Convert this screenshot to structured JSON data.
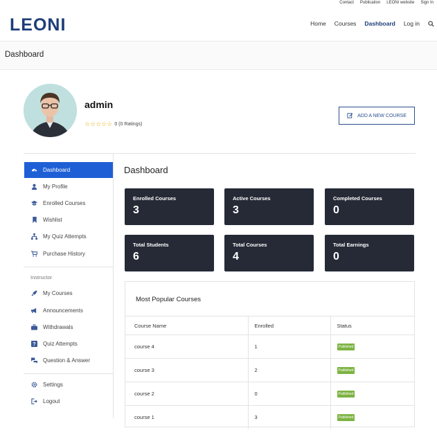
{
  "header": {
    "top_links": [
      "Contact",
      "Publication",
      "LEONI website",
      "Sign In"
    ],
    "logo": "LEONI",
    "nav": [
      {
        "label": "Home",
        "active": false
      },
      {
        "label": "Courses",
        "active": false
      },
      {
        "label": "Dashboard",
        "active": true
      },
      {
        "label": "Log in",
        "active": false
      }
    ],
    "search_icon": "search-icon"
  },
  "page": {
    "title": "Dashboard"
  },
  "profile": {
    "username": "admin",
    "stars": "☆☆☆☆☆",
    "rating_text": "0 (0 Ratings)",
    "add_course_label": "ADD A NEW COURSE"
  },
  "sidebar": {
    "items": [
      {
        "label": "Dashboard",
        "icon": "dashboard-icon",
        "active": true
      },
      {
        "label": "My Profile",
        "icon": "user-icon"
      },
      {
        "label": "Enrolled Courses",
        "icon": "graduation-cap-icon"
      },
      {
        "label": "Wishlist",
        "icon": "bookmark-icon"
      },
      {
        "label": "My Quiz Attempts",
        "icon": "sitemap-icon"
      },
      {
        "label": "Purchase History",
        "icon": "cart-icon"
      }
    ],
    "instructor_label": "Instructor",
    "instructor_items": [
      {
        "label": "My Courses",
        "icon": "rocket-icon"
      },
      {
        "label": "Announcements",
        "icon": "megaphone-icon"
      },
      {
        "label": "Withdrawals",
        "icon": "briefcase-icon"
      },
      {
        "label": "Quiz Attempts",
        "icon": "quiz-icon"
      },
      {
        "label": "Question & Answer",
        "icon": "qa-icon"
      }
    ],
    "bottom_items": [
      {
        "label": "Settings",
        "icon": "gear-icon"
      },
      {
        "label": "Logout",
        "icon": "logout-icon"
      }
    ]
  },
  "main": {
    "title": "Dashboard",
    "stats": [
      {
        "label": "Enrolled Courses",
        "value": "3"
      },
      {
        "label": "Active Courses",
        "value": "3"
      },
      {
        "label": "Completed Courses",
        "value": "0"
      },
      {
        "label": "Total Students",
        "value": "6"
      },
      {
        "label": "Total Courses",
        "value": "4"
      },
      {
        "label": "Total Earnings",
        "value": "0"
      }
    ],
    "popular": {
      "title": "Most Popular Courses",
      "columns": [
        "Course Name",
        "Enrolled",
        "Status"
      ],
      "rows": [
        {
          "name": "course 4",
          "enrolled": "1",
          "status": "Published"
        },
        {
          "name": "course 3",
          "enrolled": "2",
          "status": "Published"
        },
        {
          "name": "course 2",
          "enrolled": "0",
          "status": "Published"
        },
        {
          "name": "course 1",
          "enrolled": "3",
          "status": "Published"
        }
      ]
    }
  },
  "colors": {
    "brand": "#1d3c78",
    "active_sidebar": "#1f5fd6",
    "card_bg": "#252a36",
    "badge": "#7cb342"
  }
}
